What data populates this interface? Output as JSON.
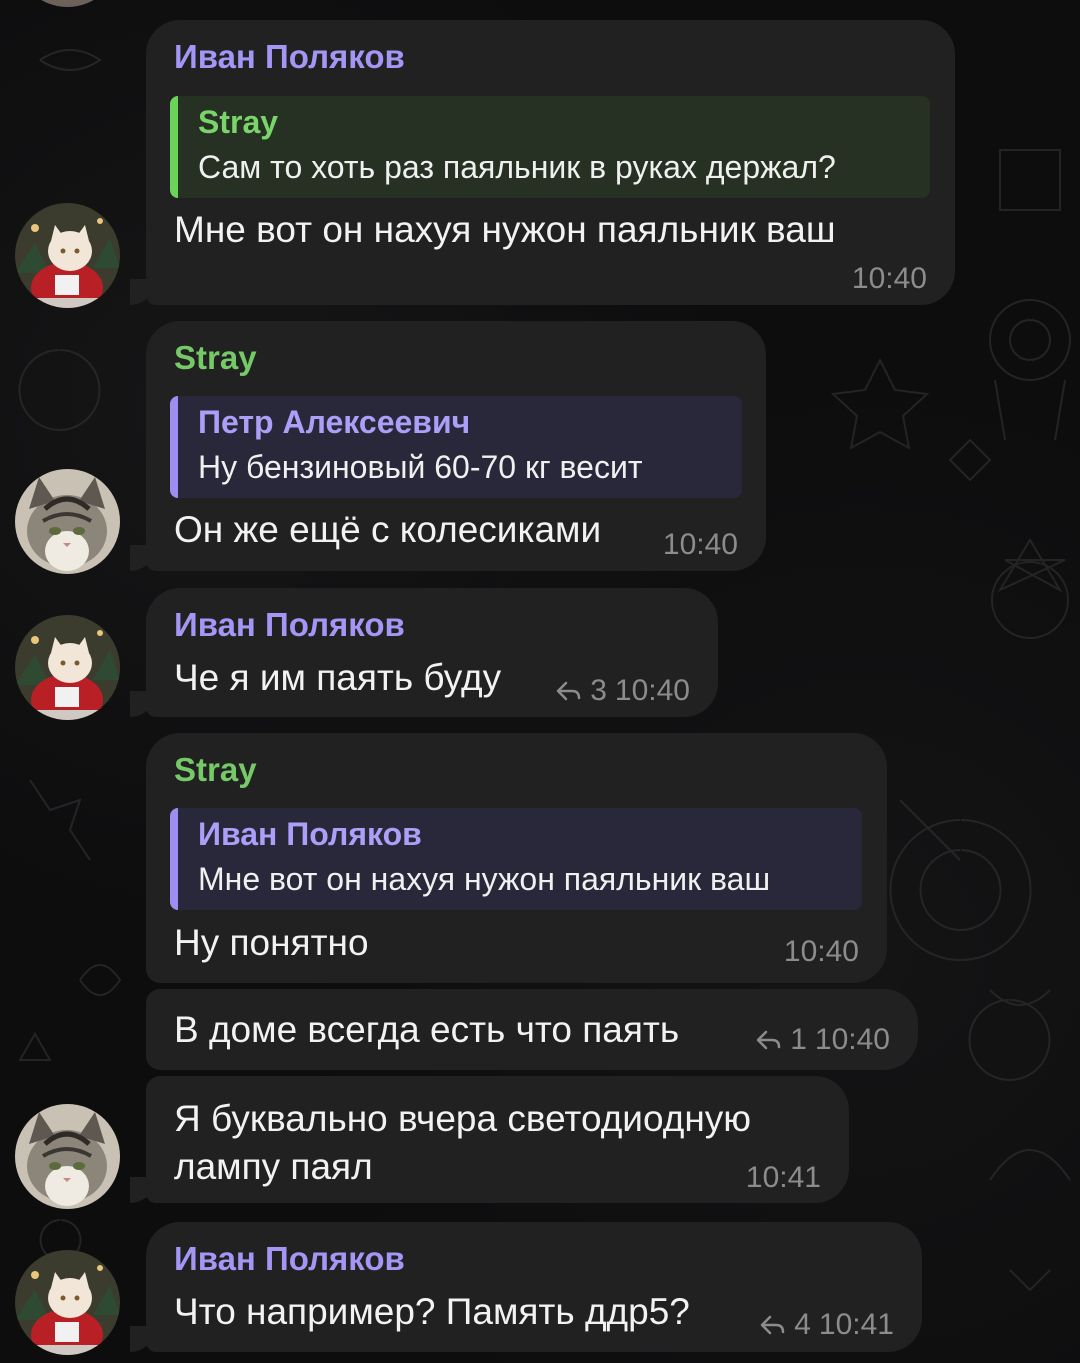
{
  "messages": [
    {
      "sender": "Иван Поляков",
      "reply": {
        "name": "Stray",
        "text": "Сам то хоть раз паяльник в руках держал?"
      },
      "text": "Мне вот он нахуя нужон паяльник ваш",
      "time": "10:40"
    },
    {
      "sender": "Stray",
      "reply": {
        "name": "Петр Алексеевич",
        "text": "Ну бензиновый 60-70 кг весит"
      },
      "text": "Он же ещё с колесиками",
      "time": "10:40"
    },
    {
      "sender": "Иван Поляков",
      "text": "Че я им паять буду",
      "replies_count": "3",
      "time": "10:40"
    },
    {
      "sender": "Stray",
      "reply": {
        "name": "Иван Поляков",
        "text": "Мне вот он нахуя нужон паяльник ваш"
      },
      "text": "Ну понятно",
      "time": "10:40"
    },
    {
      "text": "В доме всегда есть что паять",
      "replies_count": "1",
      "time": "10:40"
    },
    {
      "text_line1": "Я буквально вчера светодиодную",
      "text_line2": "лампу паял",
      "time": "10:41"
    },
    {
      "sender": "Иван Поляков",
      "text": "Что например? Память ддр5?",
      "replies_count": "4",
      "time": "10:41"
    }
  ],
  "colors": {
    "bubble": "#212121",
    "ivan_name": "#a396f4",
    "stray_name": "#75c966",
    "time": "#8c8c8c"
  },
  "icons": [
    "reply-arrow-icon",
    "avatar-cat-santa",
    "avatar-cat-tabby"
  ]
}
